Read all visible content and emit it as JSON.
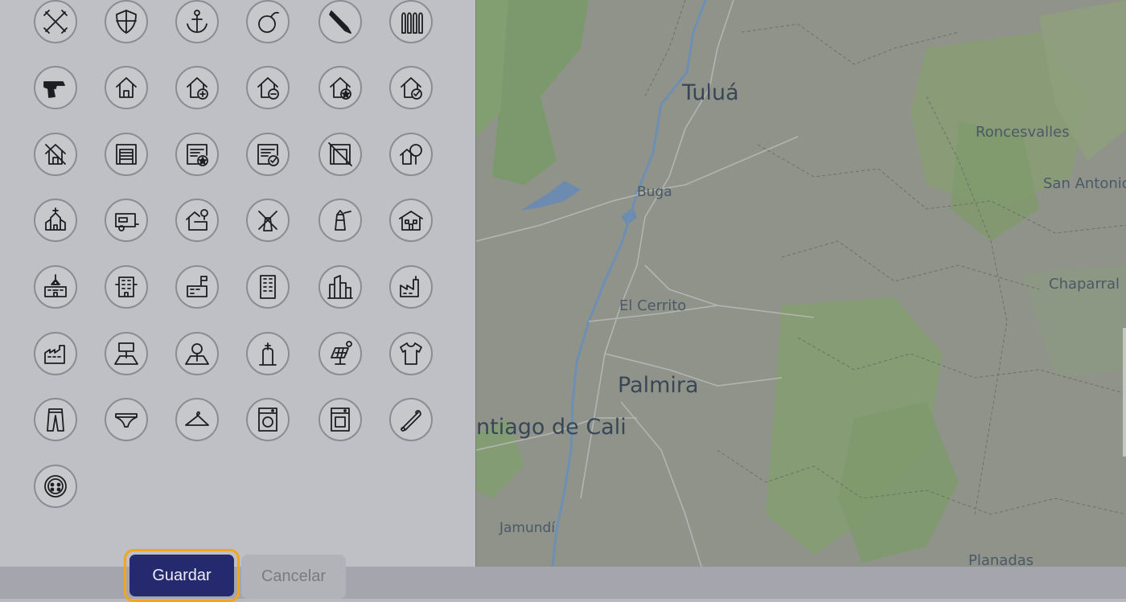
{
  "icon_picker": {
    "icons": [
      [
        "swords-icon",
        "shield-icon",
        "anchor-icon",
        "bomb-icon",
        "knife-icon",
        "bullets-icon"
      ],
      [
        "revolver-icon",
        "house-icon",
        "house-plus-icon",
        "house-minus-icon",
        "house-star-icon",
        "house-check-icon"
      ],
      [
        "house-damaged-icon",
        "garage-icon",
        "garage-star-icon",
        "garage-check-icon",
        "garage-closed-icon",
        "house-tree-icon"
      ],
      [
        "church-icon",
        "trailer-icon",
        "house-location-icon",
        "windmill-icon",
        "lighthouse-icon",
        "school-building-icon"
      ],
      [
        "school-icon",
        "apartment-icon",
        "factory-flag-icon",
        "office-building-icon",
        "city-buildings-icon",
        "factory-icon"
      ],
      [
        "industry-icon",
        "billboard-lot-icon",
        "tree-lot-icon",
        "grave-icon",
        "solar-panel-icon",
        "t-shirt-icon"
      ],
      [
        "pants-icon",
        "underwear-icon",
        "hanger-icon",
        "washing-machine-icon",
        "dryer-icon",
        "safety-pin-icon"
      ],
      [
        "button-icon"
      ]
    ]
  },
  "map": {
    "labels": {
      "tulua": "Tuluá",
      "roncesvalles": "Roncesvalles",
      "san_antonio": "San Antonio",
      "buga": "Buga",
      "chaparral": "Chaparral",
      "el_cerrito": "El Cerrito",
      "palmira": "Palmira",
      "cali": "ntiago de Cali",
      "jamundi": "Jamundí",
      "planadas": "Planadas"
    }
  },
  "footer": {
    "save_label": "Guardar",
    "cancel_label": "Cancelar"
  },
  "colors": {
    "accent": "#25296e",
    "focus_ring": "#f4a51f"
  }
}
